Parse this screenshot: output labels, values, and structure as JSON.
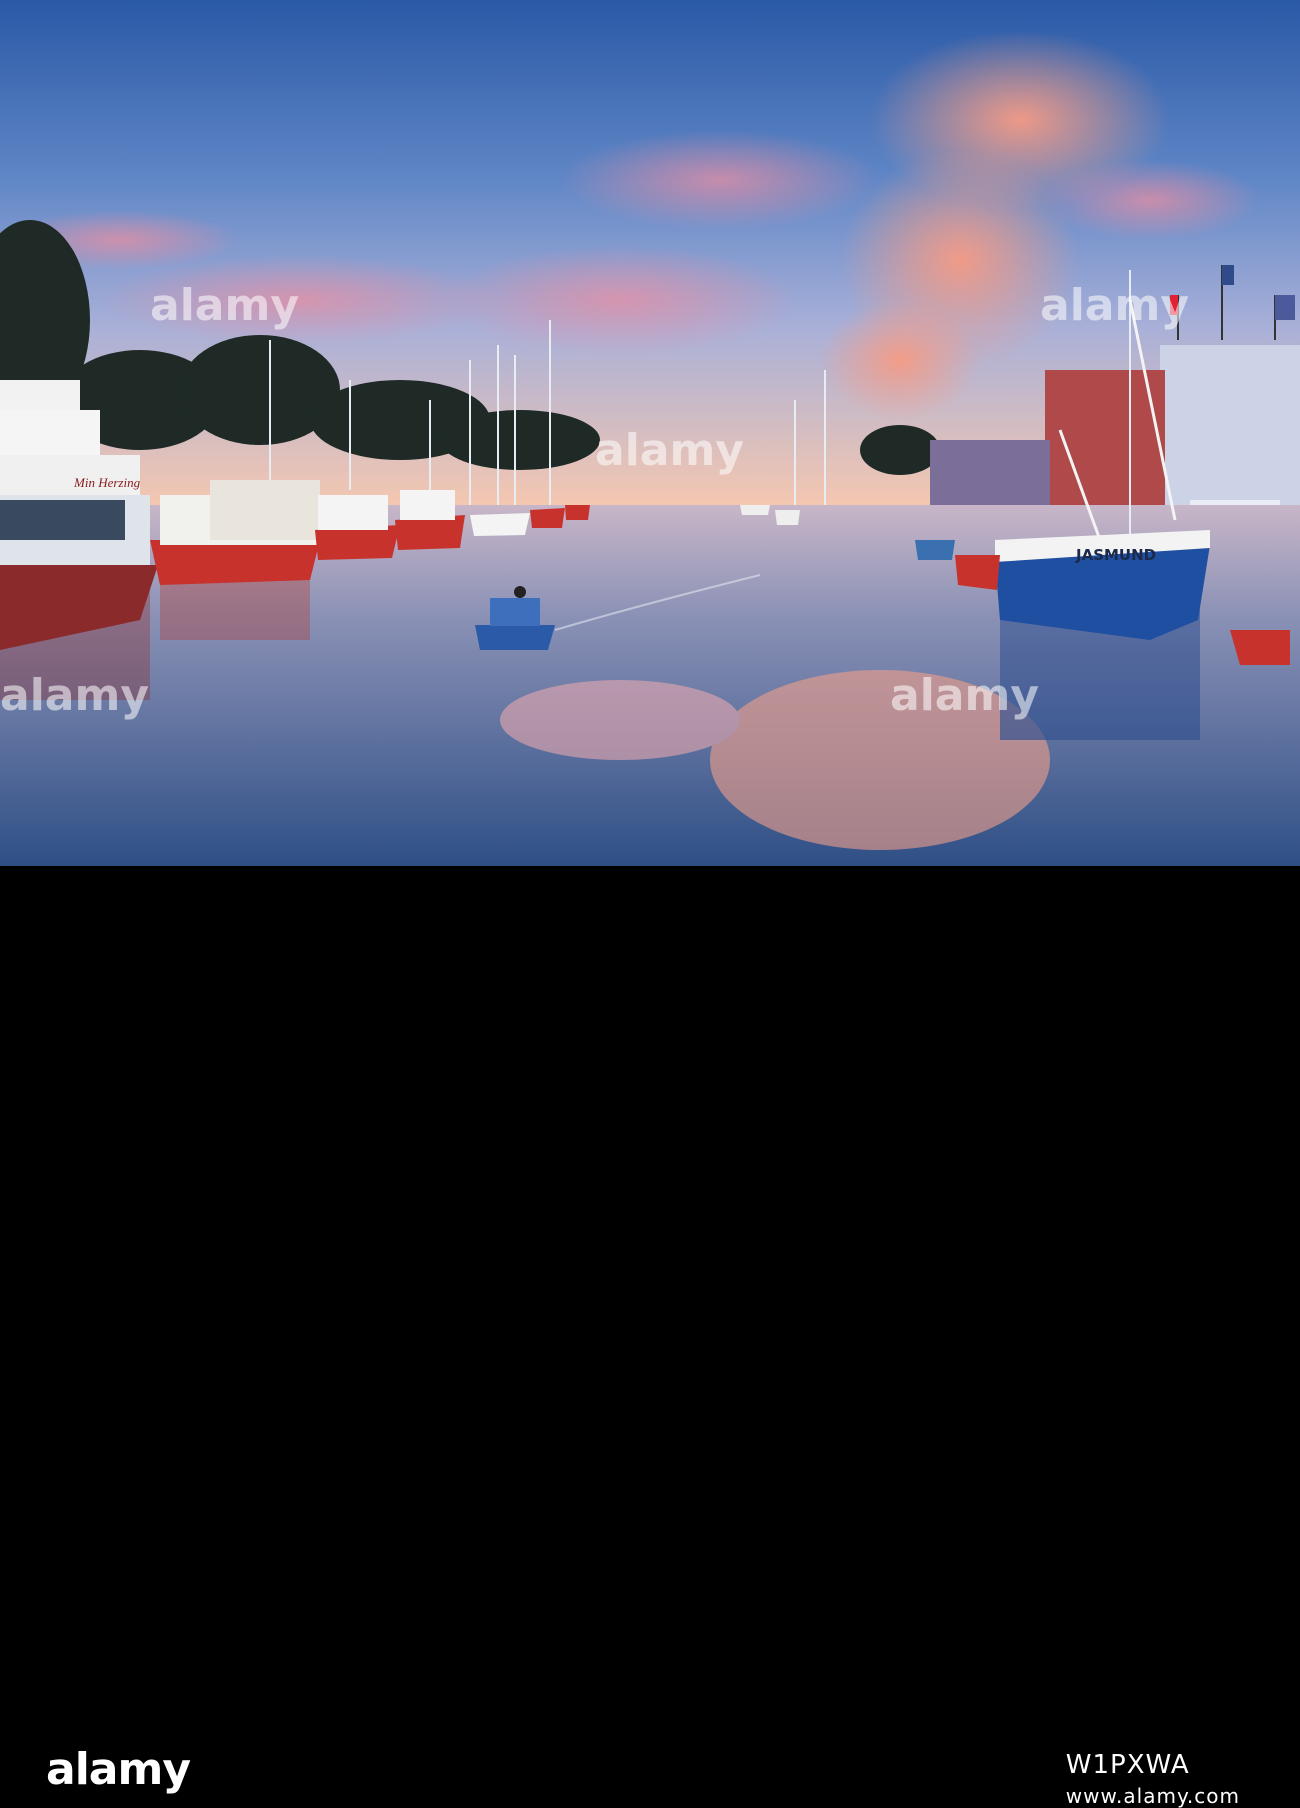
{
  "image": {
    "alt": "Harbour canal at sunset with fishing boats and pink clouds reflected in the water",
    "palette": {
      "sky_top": "#2f5fa8",
      "sky_mid": "#7b8fc7",
      "cloud_pink": "#f08a78",
      "water": "#3f5b8a",
      "boat_red": "#c8322d",
      "boat_blue": "#1f4fa0"
    }
  },
  "boats": {
    "left_ship_name": "Min Herzing",
    "right_ship_name": "JASMUND"
  },
  "watermark": {
    "brand": "alamy",
    "image_code": "W1PXWA",
    "site": "www.alamy.com"
  }
}
